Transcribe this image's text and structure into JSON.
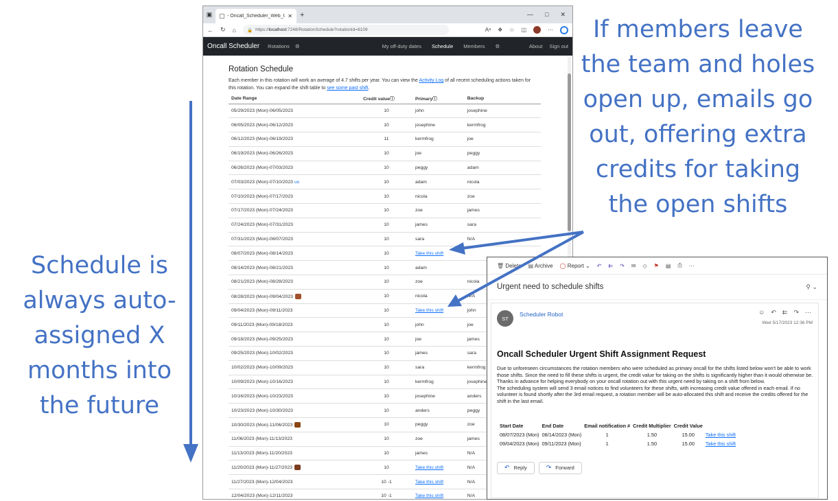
{
  "annotations": {
    "right_lines": [
      "If members leave",
      "the team and holes",
      "open up, emails go",
      "out, offering extra",
      "credits for taking",
      "the open shifts"
    ],
    "left_lines": [
      "Schedule is",
      "always auto-",
      "assigned X",
      "months into",
      "the future"
    ],
    "color": "#4472c4"
  },
  "browser": {
    "tab_title": "- Oncall_Scheduler_Web_UI",
    "url_prefix": "https://",
    "url_host": "localhost",
    "url_rest": ":7248/RotationSchedule?rotationId=8109",
    "nav": {
      "brand": "Oncall Scheduler",
      "rotations": "Rotations",
      "my_offduty": "My off-duty dates",
      "schedule": "Schedule",
      "members": "Members",
      "about": "About",
      "signout": "Sign out"
    }
  },
  "page": {
    "heading": "Rotation Schedule",
    "desc_part1": "Each member in this rotation will work an average of 4.7 shifts per year. You can view the ",
    "desc_link1": "Activity Log",
    "desc_part2": " of all recent scheduling actions taken for this rotation. You can expand the shift table to ",
    "desc_link2": "see some past shift",
    "desc_part3": ".",
    "columns": [
      "Date Range",
      "Credit valueⓘ",
      "Primaryⓘ",
      "Backup"
    ],
    "take_label": "Take this shift",
    "us_label": "us",
    "rows": [
      [
        "05/29/2023 (Mon)-06/05/2023",
        "10",
        "john",
        "josephine"
      ],
      [
        "06/05/2023 (Mon)-06/12/2023",
        "10",
        "josephine",
        "kermfrog"
      ],
      [
        "06/12/2023 (Mon)-06/19/2023",
        "11",
        "kermfrog",
        "joe"
      ],
      [
        "06/19/2023 (Mon)-06/26/2023",
        "10",
        "joe",
        "peggy"
      ],
      [
        "06/26/2023 (Mon)-07/03/2023",
        "10",
        "peggy",
        "adam"
      ],
      [
        "07/03/2023 (Mon)-07/10/2023",
        "10",
        "adam",
        "nicola"
      ],
      [
        "07/10/2023 (Mon)-07/17/2023",
        "10",
        "nicola",
        "zoe"
      ],
      [
        "07/17/2023 (Mon)-07/24/2023",
        "10",
        "zoe",
        "james"
      ],
      [
        "07/24/2023 (Mon)-07/31/2023",
        "10",
        "james",
        "sara"
      ],
      [
        "07/31/2023 (Mon)-08/07/2023",
        "10",
        "sara",
        "N/A"
      ],
      [
        "08/07/2023 (Mon)-08/14/2023",
        "10",
        "Take this shift",
        ""
      ],
      [
        "08/14/2023 (Mon)-08/21/2023",
        "10",
        "adam",
        ""
      ],
      [
        "08/21/2023 (Mon)-08/28/2023",
        "10",
        "zoe",
        "nicola"
      ],
      [
        "08/28/2023 (Mon)-09/04/2023",
        "10",
        "nicola",
        "N/A"
      ],
      [
        "09/04/2023 (Mon)-09/11/2023",
        "10",
        "Take this shift",
        "john"
      ],
      [
        "09/11/2023 (Mon)-09/18/2023",
        "10",
        "john",
        "joe"
      ],
      [
        "09/18/2023 (Mon)-09/25/2023",
        "10",
        "joe",
        "james"
      ],
      [
        "09/25/2023 (Mon)-10/02/2023",
        "10",
        "james",
        "sara"
      ],
      [
        "10/02/2023 (Mon)-10/09/2023",
        "10",
        "sara",
        "kermfrog"
      ],
      [
        "10/09/2023 (Mon)-10/16/2023",
        "10",
        "kermfrog",
        "josephine"
      ],
      [
        "10/16/2023 (Mon)-10/23/2023",
        "10",
        "josephine",
        "anders"
      ],
      [
        "10/23/2023 (Mon)-10/30/2023",
        "10",
        "anders",
        "peggy"
      ],
      [
        "10/30/2023 (Mon)-11/06/2023",
        "10",
        "peggy",
        "zoe"
      ],
      [
        "11/06/2023 (Mon)-11/13/2023",
        "10",
        "zoe",
        "james"
      ],
      [
        "11/13/2023 (Mon)-11/20/2023",
        "10",
        "james",
        "N/A"
      ],
      [
        "11/20/2023 (Mon)-11/27/2023",
        "10",
        "Take this shift",
        "N/A"
      ],
      [
        "11/27/2023 (Mon)-12/04/2023",
        "10 -1",
        "Take this shift",
        "N/A"
      ],
      [
        "12/04/2023 (Mon)-12/11/2023",
        "10 -1",
        "Take this shift",
        "N/A"
      ]
    ]
  },
  "email": {
    "toolbar": {
      "delete": "Delete",
      "archive": "Archive",
      "report": "Report"
    },
    "subject": "Urgent need to schedule shifts",
    "sender_initials": "ST",
    "sender_name": "Scheduler Robot",
    "date": "Wed 5/17/2023 12:36 PM",
    "heading": "Oncall Scheduler Urgent Shift Assignment Request",
    "para1": "Due to unforeseen circumstances the rotation members who were scheduled as primary oncall for the shifts listed below won't be able to work those shifts. Since the need to fill these shifts is urgent, the credit value for taking on the shifts is significantly higher than it would otherwise be.",
    "para2": "Thanks in advance for helping everybody on your oncall rotation out with this urgent need by taking on a shift from below.",
    "para3": "The scheduling system will send 3 email notices to find volunteers for these shifts, with increasing credit value offered in each email. If no volunteer is found shortly after the 3rd email request, a rotation member will be auto-allocated this shift and receive the credits offered for the shift in the last email.",
    "table_headers": [
      "Start Date",
      "End Date",
      "Email notification #",
      "Credit Multiplier",
      "Credit Value",
      ""
    ],
    "table_rows": [
      [
        "08/07/2023 (Mon)",
        "08/14/2023 (Mon)",
        "1",
        "1.50",
        "15.00",
        "Take this shift"
      ],
      [
        "09/04/2023 (Mon)",
        "09/11/2023 (Mon)",
        "1",
        "1.50",
        "15.00",
        "Take this shift"
      ]
    ],
    "reply": "Reply",
    "forward": "Forward"
  }
}
